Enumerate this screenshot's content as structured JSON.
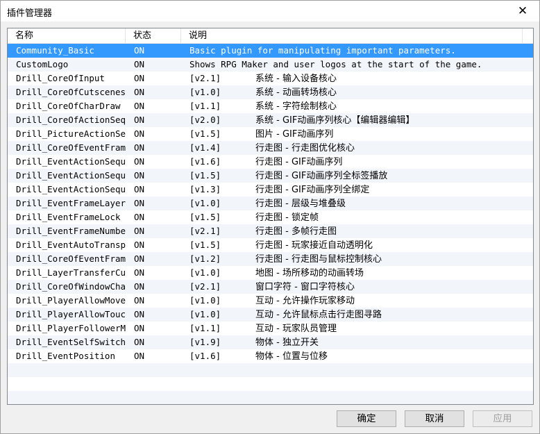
{
  "window": {
    "title": "插件管理器",
    "close_glyph": "✕"
  },
  "columns": {
    "name": "名称",
    "status": "状态",
    "description": "说明"
  },
  "rows": [
    {
      "name": "Community_Basic",
      "status": "ON",
      "version": "",
      "description": "Basic plugin for manipulating important parameters.",
      "selected": true
    },
    {
      "name": "CustomLogo",
      "status": "ON",
      "version": "",
      "description": "Shows RPG Maker and user logos at the start of the game."
    },
    {
      "name": "Drill_CoreOfInput",
      "status": "ON",
      "version": "[v2.1]",
      "description": "系统 - 输入设备核心"
    },
    {
      "name": "Drill_CoreOfCutscenes",
      "status": "ON",
      "version": "[v1.0]",
      "description": "系统 - 动画转场核心"
    },
    {
      "name": "Drill_CoreOfCharDraw",
      "status": "ON",
      "version": "[v1.1]",
      "description": "系统 - 字符绘制核心"
    },
    {
      "name": "Drill_CoreOfActionSeq…",
      "status": "ON",
      "version": "[v2.0]",
      "description": "系统 - GIF动画序列核心【编辑器编辑】"
    },
    {
      "name": "Drill_PictureActionSe…",
      "status": "ON",
      "version": "[v1.5]",
      "description": "图片 - GIF动画序列"
    },
    {
      "name": "Drill_CoreOfEventFrame",
      "status": "ON",
      "version": "[v1.4]",
      "description": "行走图 - 行走图优化核心"
    },
    {
      "name": "Drill_EventActionSequ…",
      "status": "ON",
      "version": "[v1.6]",
      "description": "行走图 - GIF动画序列"
    },
    {
      "name": "Drill_EventActionSequ…",
      "status": "ON",
      "version": "[v1.5]",
      "description": "行走图 - GIF动画序列全标签播放"
    },
    {
      "name": "Drill_EventActionSequ…",
      "status": "ON",
      "version": "[v1.3]",
      "description": "行走图 - GIF动画序列全绑定"
    },
    {
      "name": "Drill_EventFrameLayer…",
      "status": "ON",
      "version": "[v1.0]",
      "description": "行走图 - 层级与堆叠级"
    },
    {
      "name": "Drill_EventFrameLock",
      "status": "ON",
      "version": "[v1.5]",
      "description": "行走图 - 锁定帧"
    },
    {
      "name": "Drill_EventFrameNumber",
      "status": "ON",
      "version": "[v2.1]",
      "description": "行走图 - 多帧行走图"
    },
    {
      "name": "Drill_EventAutoTransp…",
      "status": "ON",
      "version": "[v1.5]",
      "description": "行走图 - 玩家接近自动透明化"
    },
    {
      "name": "Drill_CoreOfEventFram…",
      "status": "ON",
      "version": "[v1.2]",
      "description": "行走图 - 行走图与鼠标控制核心"
    },
    {
      "name": "Drill_LayerTransferCu…",
      "status": "ON",
      "version": "[v1.0]",
      "description": "地图 - 场所移动的动画转场"
    },
    {
      "name": "Drill_CoreOfWindowCha…",
      "status": "ON",
      "version": "[v2.1]",
      "description": "窗口字符 - 窗口字符核心"
    },
    {
      "name": "Drill_PlayerAllowMove",
      "status": "ON",
      "version": "[v1.0]",
      "description": "互动 - 允许操作玩家移动"
    },
    {
      "name": "Drill_PlayerAllowTouc…",
      "status": "ON",
      "version": "[v1.0]",
      "description": "互动 - 允许鼠标点击行走图寻路"
    },
    {
      "name": "Drill_PlayerFollowerM…",
      "status": "ON",
      "version": "[v1.1]",
      "description": "互动 - 玩家队员管理"
    },
    {
      "name": "Drill_EventSelfSwitch",
      "status": "ON",
      "version": "[v1.9]",
      "description": "物体 - 独立开关"
    },
    {
      "name": "Drill_EventPosition",
      "status": "ON",
      "version": "[v1.6]",
      "description": "物体 - 位置与位移"
    }
  ],
  "buttons": {
    "ok": "确定",
    "cancel": "取消",
    "apply": "应用"
  },
  "colors": {
    "selection": "#3399ff",
    "row_alt": "#f2f5fa"
  }
}
